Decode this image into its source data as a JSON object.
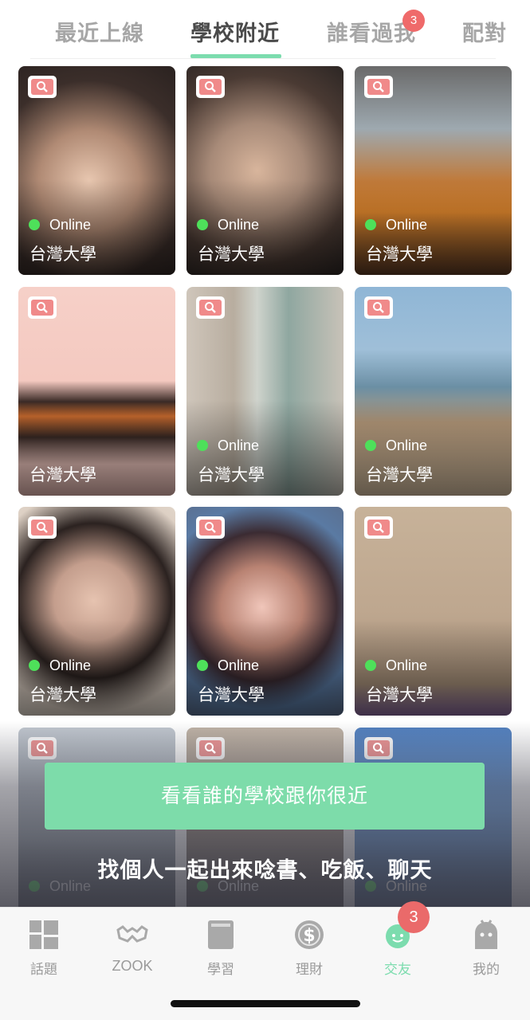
{
  "top_tabs": {
    "items": [
      {
        "label": "最近上線"
      },
      {
        "label": "學校附近"
      },
      {
        "label": "誰看過我",
        "badge": "3"
      },
      {
        "label": "配對"
      }
    ],
    "active_index": 1
  },
  "cards": [
    {
      "online": true,
      "status": "Online",
      "school": "台灣大學"
    },
    {
      "online": true,
      "status": "Online",
      "school": "台灣大學"
    },
    {
      "online": true,
      "status": "Online",
      "school": "台灣大學"
    },
    {
      "online": false,
      "status": "",
      "school": "台灣大學"
    },
    {
      "online": true,
      "status": "Online",
      "school": "台灣大學"
    },
    {
      "online": true,
      "status": "Online",
      "school": "台灣大學"
    },
    {
      "online": true,
      "status": "Online",
      "school": "台灣大學"
    },
    {
      "online": true,
      "status": "Online",
      "school": "台灣大學"
    },
    {
      "online": true,
      "status": "Online",
      "school": "台灣大學"
    },
    {
      "online": true,
      "status": "Online",
      "school": ""
    },
    {
      "online": true,
      "status": "Online",
      "school": ""
    },
    {
      "online": true,
      "status": "Online",
      "school": ""
    }
  ],
  "overlay": {
    "cta_label": "看看誰的學校跟你很近",
    "subtitle": "找個人一起出來唸書、吃飯、聊天"
  },
  "bottom_nav": {
    "items": [
      {
        "label": "話題",
        "icon": "grid-icon"
      },
      {
        "label": "ZOOK",
        "icon": "glasses-icon"
      },
      {
        "label": "學習",
        "icon": "book-icon"
      },
      {
        "label": "理財",
        "icon": "dollar-coin-icon"
      },
      {
        "label": "交友",
        "icon": "smiley-leaf-icon"
      },
      {
        "label": "我的",
        "icon": "ghost-icon"
      }
    ],
    "active_index": 4,
    "badge": "3"
  },
  "colors": {
    "accent": "#7cdcae",
    "badge": "#ea6a6a",
    "online_dot": "#4ee05a"
  }
}
